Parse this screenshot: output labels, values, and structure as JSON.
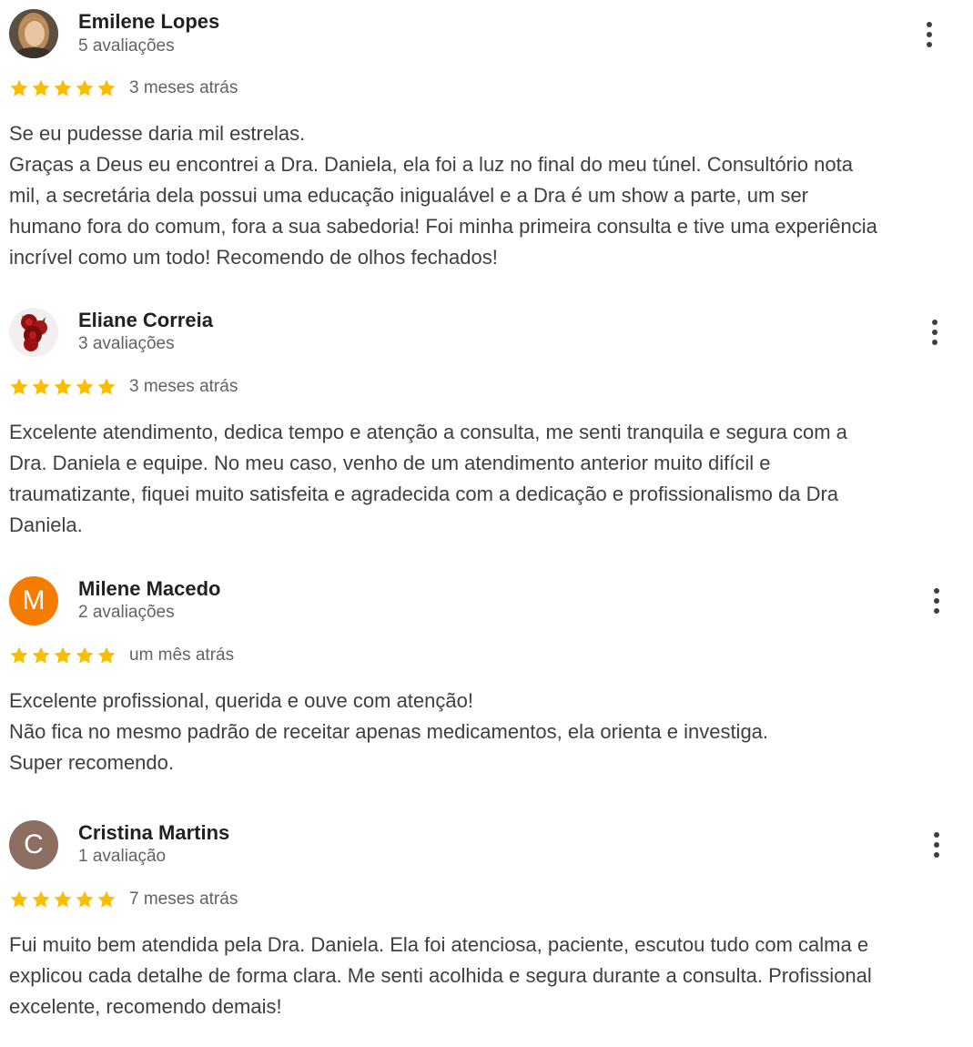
{
  "colors": {
    "star": "#fbbc04",
    "avatar_milene": "#f57c00",
    "avatar_cristina": "#8d6e63"
  },
  "reviews": [
    {
      "name": "Emilene Lopes",
      "count": "5 avaliações",
      "rating": 5,
      "date": "3 meses atrás",
      "avatar": "photo",
      "lines": [
        "Se eu pudesse daria mil estrelas.",
        "Graças a Deus eu encontrei a Dra. Daniela, ela foi a luz no final do meu túnel. Consultório nota",
        "mil, a secretária dela possui uma educação inigualável e a Dra é um show a parte, um ser",
        "humano fora do comum, fora a sua sabedoria! Foi minha primeira consulta e tive uma experiência",
        "incrível como um todo! Recomendo de olhos fechados!"
      ]
    },
    {
      "name": "Eliane Correia",
      "count": "3 avaliações",
      "rating": 5,
      "date": "3 meses atrás",
      "avatar": "roses-photo",
      "lines": [
        "Excelente atendimento, dedica tempo e atenção a consulta, me senti tranquila e segura com a",
        "Dra. Daniela e equipe. No meu caso, venho de um atendimento anterior muito difícil e",
        "traumatizante, fiquei muito satisfeita e agradecida com a dedicação e profissionalismo da Dra",
        "Daniela."
      ]
    },
    {
      "name": "Milene Macedo",
      "count": "2 avaliações",
      "rating": 5,
      "date": "um mês atrás",
      "avatar_letter": "M",
      "lines": [
        "Excelente profissional, querida e ouve com atenção!",
        "Não fica no mesmo padrão de receitar apenas medicamentos, ela orienta e investiga.",
        "Super recomendo."
      ]
    },
    {
      "name": "Cristina Martins",
      "count": "1 avaliação",
      "rating": 5,
      "date": "7 meses atrás",
      "avatar_letter": "C",
      "lines": [
        "Fui muito bem atendida pela Dra. Daniela. Ela foi atenciosa, paciente, escutou tudo com calma e",
        "explicou cada detalhe de forma clara. Me senti acolhida e segura durante a consulta. Profissional",
        "excelente, recomendo demais!"
      ]
    }
  ]
}
